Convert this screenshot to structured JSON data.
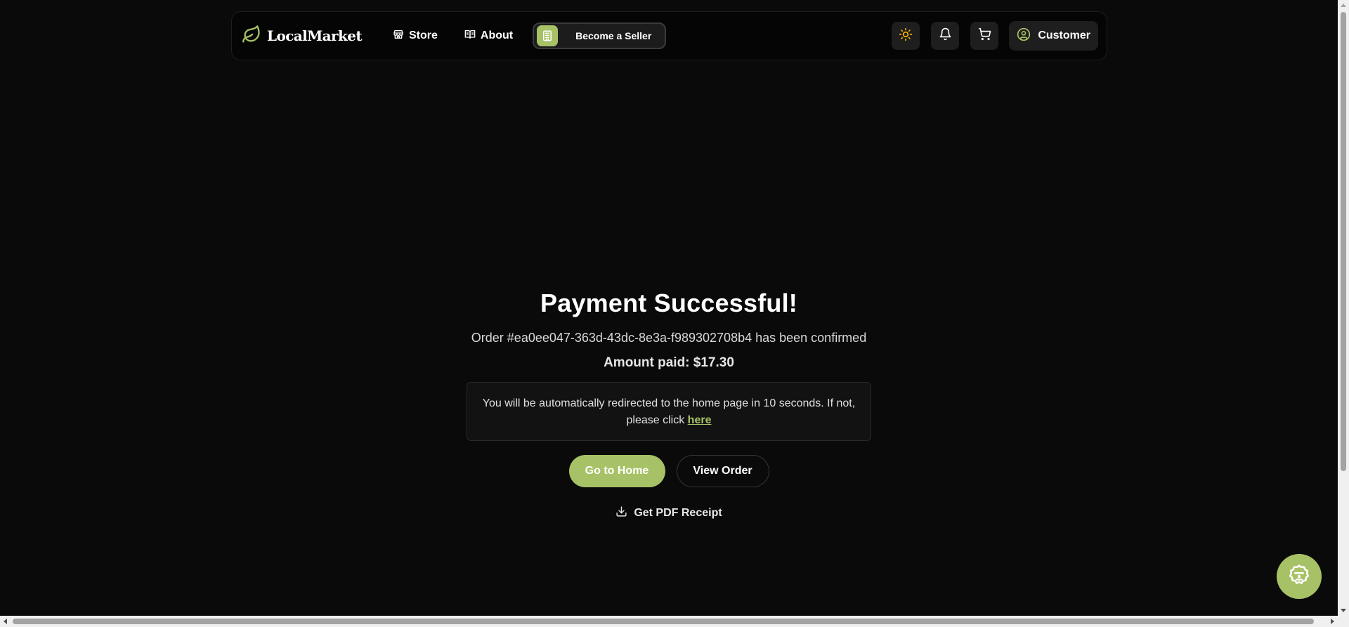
{
  "colors": {
    "background": "#0a0a0a",
    "accent": "#a7c266",
    "sun": "#f5b400"
  },
  "nav": {
    "brand": "LocalMarket",
    "brand_icon": "leaf-icon",
    "links": [
      {
        "label": "Store",
        "icon": "store-icon"
      },
      {
        "label": "About",
        "icon": "book-open-icon"
      }
    ],
    "seller_button": {
      "label": "Become a Seller",
      "icon": "store-building-icon"
    },
    "icons": [
      "sun-icon",
      "bell-icon",
      "cart-icon"
    ],
    "user": {
      "label": "Customer",
      "icon": "user-circle-icon"
    }
  },
  "main": {
    "title": "Payment Successful!",
    "order_text": "Order #ea0ee047-363d-43dc-8e3a-f989302708b4 has been confirmed",
    "amount_text": "Amount paid: $17.30",
    "redirect_text": "You will be automatically redirected to the home page in 10 seconds. If not, please click",
    "redirect_link": "here",
    "primary_button": "Go to Home",
    "secondary_button": "View Order",
    "pdf_link": "Get PDF Receipt",
    "pdf_icon": "download-icon"
  },
  "chat": {
    "icon": "chat-bot-icon"
  }
}
